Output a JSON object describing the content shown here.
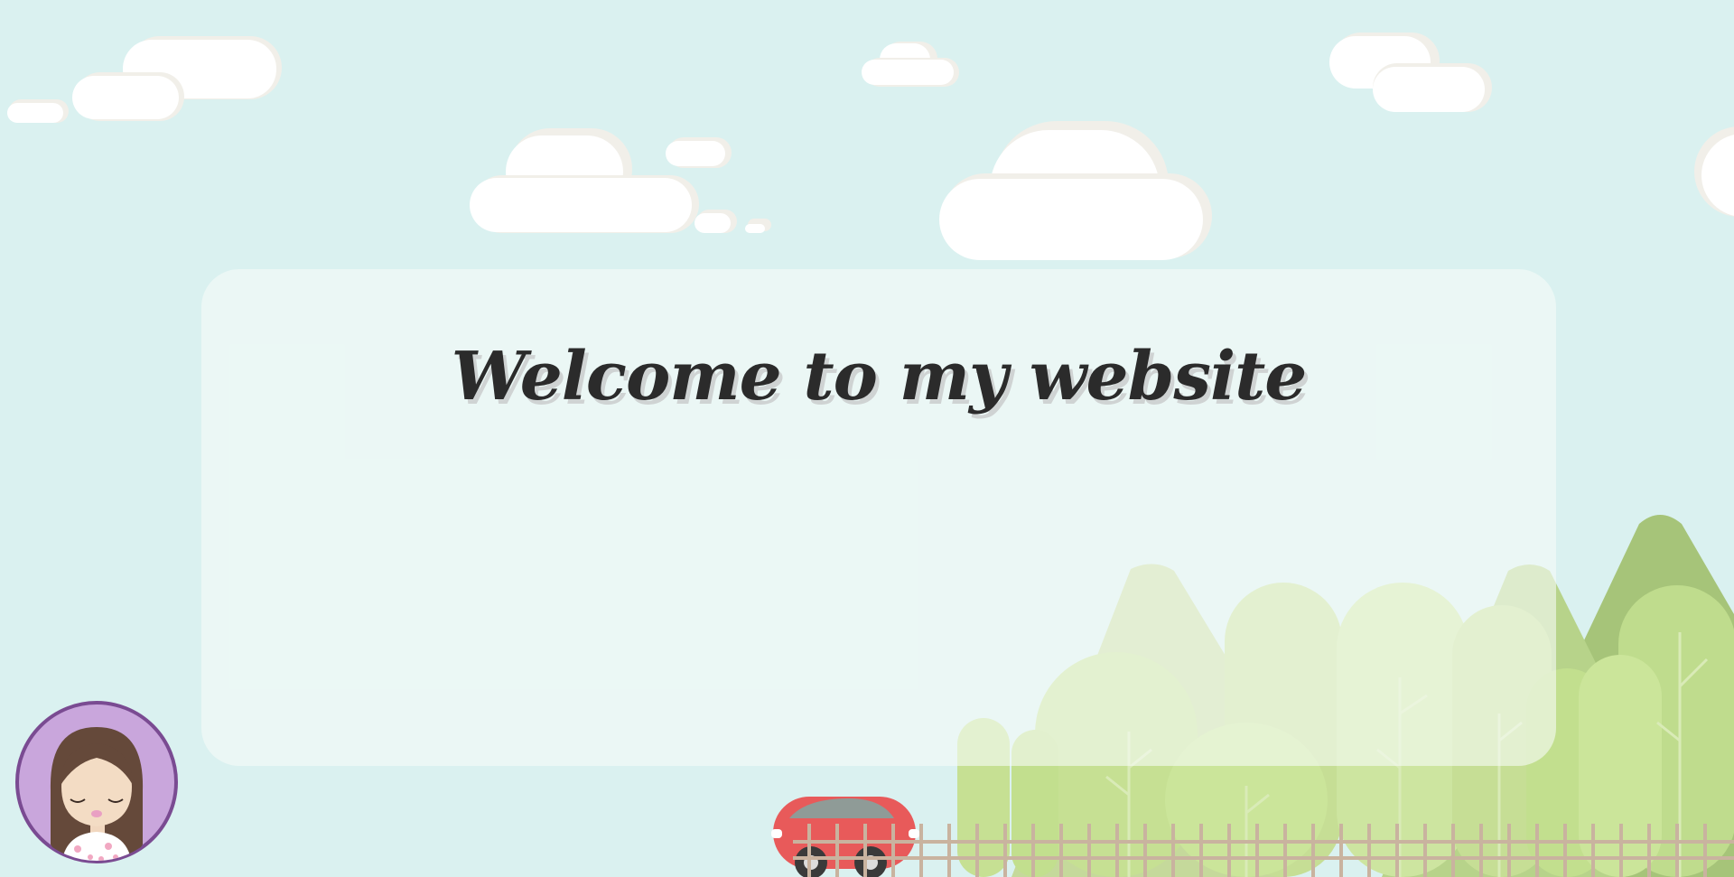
{
  "page": {
    "title": "Welcome to my website"
  },
  "colors": {
    "sky": "#daf1f0",
    "cloud": "#ffffff",
    "cloud_shadow": "#f1efe9",
    "hill_green": "#a6c479",
    "tree_green": "#bfdc8d",
    "fence": "#c9b39f",
    "car_red": "#e85a5a",
    "avatar_ring": "#7a4b92",
    "avatar_bg": "#c9a6dc"
  },
  "icons": {
    "avatar": "girl-avatar-icon",
    "car": "red-car-icon"
  }
}
